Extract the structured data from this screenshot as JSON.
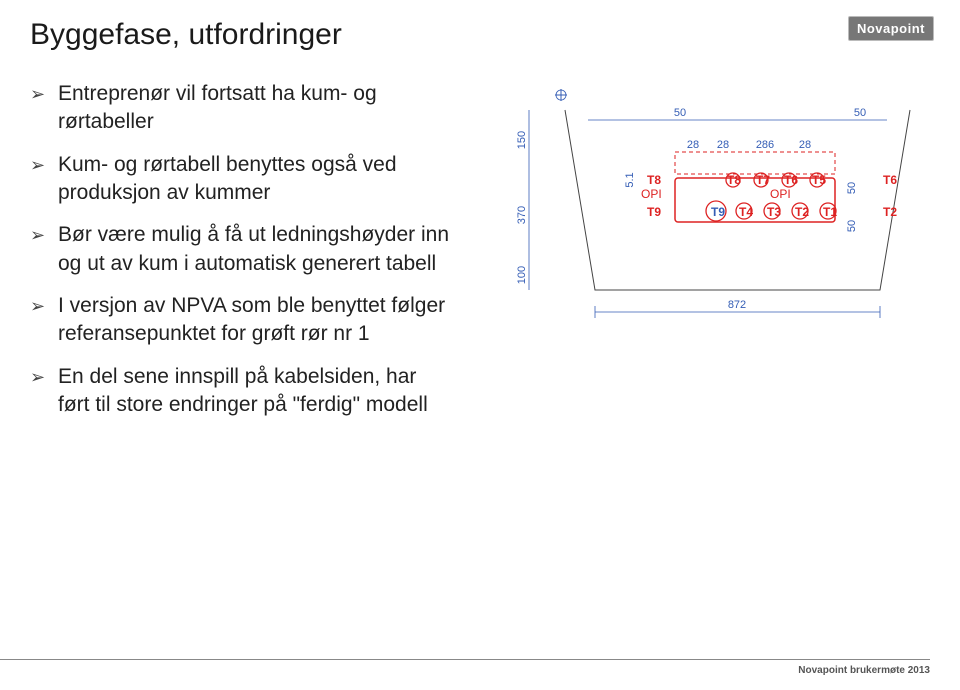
{
  "title": "Byggefase, utfordringer",
  "brand": "Novapoint",
  "bullets": [
    "Entreprenør vil fortsatt ha kum- og rørtabeller",
    "Kum- og rørtabell benyttes også ved produksjon av kummer",
    "Bør være mulig å få ut ledningshøyder inn og ut av kum i automatisk generert tabell",
    "I versjon av NPVA som ble benyttet følger referansepunktet for grøft rør nr 1",
    "En del sene innspill på kabelsiden, har ført til store endringer på \"ferdig\" modell"
  ],
  "diagram": {
    "dim_left_upper": "150",
    "dim_left_mid": "370",
    "dim_left_lower": "100",
    "dim_bottom": "872",
    "dim_top_left": "50",
    "dim_top_right": "50",
    "dim_mid_a": "28",
    "dim_mid_b": "28",
    "dim_mid_c": "286",
    "dim_mid_d": "28",
    "dim_right_small_upper": "50",
    "dim_right_small_lower": "50",
    "dim_inner": "5.1",
    "opi1": "OPI",
    "opi2": "OPI",
    "labels_upper": [
      "T8",
      "T8",
      "T7",
      "T6",
      "T5",
      "T6"
    ],
    "labels_lower": [
      "T9",
      "T9",
      "T4",
      "T3",
      "T2",
      "T1",
      "T2"
    ]
  },
  "footer": "Novapoint brukermøte 2013"
}
